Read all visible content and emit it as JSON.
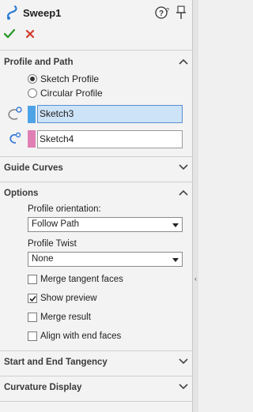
{
  "header": {
    "title": "Sweep1",
    "help_icon": "help-icon",
    "pin_icon": "pushpin-icon",
    "ok_icon": "green-check-icon",
    "cancel_icon": "red-x-icon"
  },
  "profile_and_path": {
    "title": "Profile and Path",
    "options": [
      {
        "label": "Sketch Profile",
        "selected": true
      },
      {
        "label": "Circular Profile",
        "selected": false
      }
    ],
    "profile_field": "Sketch3",
    "path_field": "Sketch4",
    "profile_color": "#4da3e6",
    "path_color": "#e07fb4"
  },
  "guide_curves": {
    "title": "Guide Curves"
  },
  "options": {
    "title": "Options",
    "profile_orientation_label": "Profile orientation:",
    "profile_orientation_value": "Follow Path",
    "profile_twist_label": "Profile Twist",
    "profile_twist_value": "None",
    "checkboxes": [
      {
        "label": "Merge tangent faces",
        "checked": false
      },
      {
        "label": "Show preview",
        "checked": true
      },
      {
        "label": "Merge result",
        "checked": false
      },
      {
        "label": "Align with end faces",
        "checked": false
      }
    ]
  },
  "start_end_tangency": {
    "title": "Start and End Tangency"
  },
  "curvature_display": {
    "title": "Curvature Display"
  }
}
